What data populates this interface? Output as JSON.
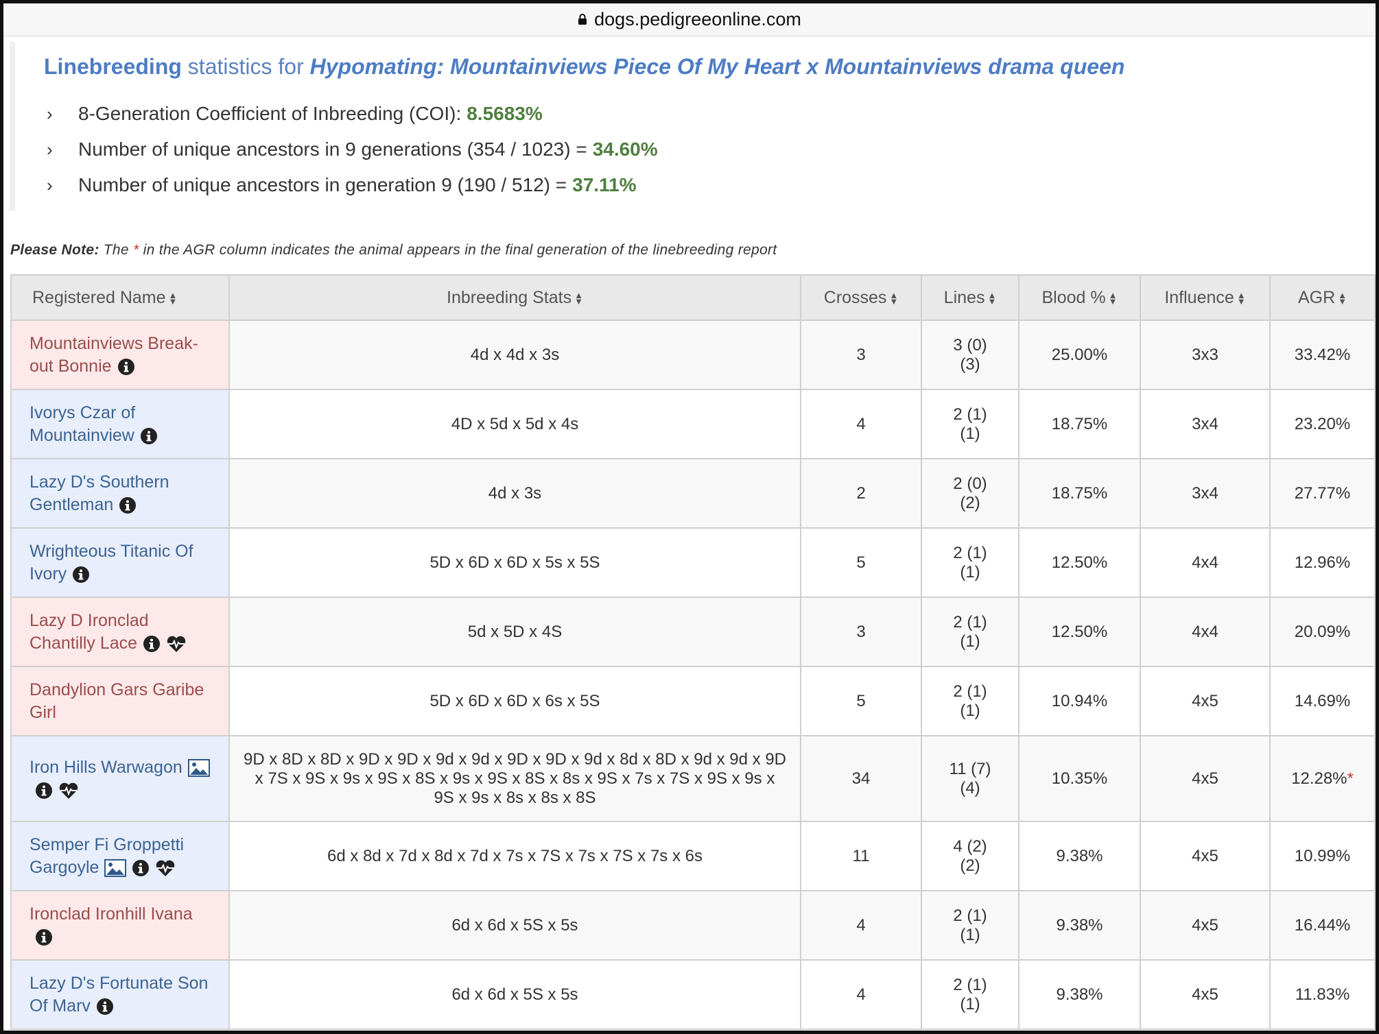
{
  "browser": {
    "url": "dogs.pedigreeonline.com"
  },
  "header": {
    "title_prefix": "Linebreeding",
    "title_mid": "statistics for",
    "title_mating": "Hypomating: Mountainviews Piece Of My Heart x Mountainviews drama queen"
  },
  "stats": [
    {
      "label": "8-Generation Coefficient of Inbreeding (COI):",
      "value": "8.5683%"
    },
    {
      "label": "Number of unique ancestors in 9 generations (354 / 1023) =",
      "value": "34.60%"
    },
    {
      "label": "Number of unique ancestors in generation 9 (190 / 512) =",
      "value": "37.11%"
    }
  ],
  "note": {
    "bold": "Please Note:",
    "pre": "The",
    "star": "*",
    "post": "in the AGR column indicates the animal appears in the final generation of the linebreeding report"
  },
  "table": {
    "headers": [
      "Registered Name",
      "Inbreeding Stats",
      "Crosses",
      "Lines",
      "Blood %",
      "Influence",
      "AGR"
    ],
    "rows": [
      {
        "sex": "female",
        "name": "Mountainviews Break-out Bonnie",
        "icons": [
          "info"
        ],
        "stats": "4d x 4d x 3s",
        "crosses": "3",
        "lines1": "3 (0)",
        "lines2": "(3)",
        "blood": "25.00%",
        "influence": "3x3",
        "agr": "33.42%",
        "agr_star": ""
      },
      {
        "sex": "male",
        "name": "Ivorys Czar of Mountainview",
        "icons": [
          "info"
        ],
        "stats": "4D x 5d x 5d x 4s",
        "crosses": "4",
        "lines1": "2 (1)",
        "lines2": "(1)",
        "blood": "18.75%",
        "influence": "3x4",
        "agr": "23.20%",
        "agr_star": ""
      },
      {
        "sex": "male",
        "name": "Lazy D's Southern Gentleman",
        "icons": [
          "info"
        ],
        "stats": "4d x 3s",
        "crosses": "2",
        "lines1": "2 (0)",
        "lines2": "(2)",
        "blood": "18.75%",
        "influence": "3x4",
        "agr": "27.77%",
        "agr_star": ""
      },
      {
        "sex": "male",
        "name": "Wrighteous Titanic Of Ivory",
        "icons": [
          "info"
        ],
        "stats": "5D x 6D x 6D x 5s x 5S",
        "crosses": "5",
        "lines1": "2 (1)",
        "lines2": "(1)",
        "blood": "12.50%",
        "influence": "4x4",
        "agr": "12.96%",
        "agr_star": ""
      },
      {
        "sex": "female",
        "name": "Lazy D Ironclad Chantilly Lace",
        "icons": [
          "info",
          "health"
        ],
        "stats": "5d x 5D x 4S",
        "crosses": "3",
        "lines1": "2 (1)",
        "lines2": "(1)",
        "blood": "12.50%",
        "influence": "4x4",
        "agr": "20.09%",
        "agr_star": ""
      },
      {
        "sex": "female",
        "name": "Dandylion Gars Garibe Girl",
        "icons": [],
        "stats": "5D x 6D x 6D x 6s x 5S",
        "crosses": "5",
        "lines1": "2 (1)",
        "lines2": "(1)",
        "blood": "10.94%",
        "influence": "4x5",
        "agr": "14.69%",
        "agr_star": ""
      },
      {
        "sex": "male",
        "name": "Iron Hills Warwagon",
        "icons": [
          "photo",
          "info",
          "health"
        ],
        "stats": "9D x 8D x 8D x 9D x 9D x 9d x 9d x 9D x 9D x 9d x 8d x 8D x 9d x 9d x 9D x 7S x 9S x 9s x 9S x 8S x 9s x 9S x 8S x 8s x 9S x 7s x 7S x 9S x 9s x 9S x 9s x 8s x 8s x 8S",
        "crosses": "34",
        "lines1": "11 (7)",
        "lines2": "(4)",
        "blood": "10.35%",
        "influence": "4x5",
        "agr": "12.28%",
        "agr_star": "*"
      },
      {
        "sex": "male",
        "name": "Semper Fi Groppetti Gargoyle",
        "icons": [
          "photo",
          "info",
          "health"
        ],
        "stats": "6d x 8d x 7d x 8d x 7d x 7s x 7S x 7s x 7S x 7s x 6s",
        "crosses": "11",
        "lines1": "4 (2)",
        "lines2": "(2)",
        "blood": "9.38%",
        "influence": "4x5",
        "agr": "10.99%",
        "agr_star": ""
      },
      {
        "sex": "female",
        "name": "Ironclad Ironhill Ivana",
        "icons": [
          "info"
        ],
        "stats": "6d x 6d x 5S x 5s",
        "crosses": "4",
        "lines1": "2 (1)",
        "lines2": "(1)",
        "blood": "9.38%",
        "influence": "4x5",
        "agr": "16.44%",
        "agr_star": ""
      },
      {
        "sex": "male",
        "name": "Lazy D's Fortunate Son Of Marv",
        "icons": [
          "info"
        ],
        "stats": "6d x 6d x 5S x 5s",
        "crosses": "4",
        "lines1": "2 (1)",
        "lines2": "(1)",
        "blood": "9.38%",
        "influence": "4x5",
        "agr": "11.83%",
        "agr_star": ""
      }
    ]
  },
  "colors": {
    "title_blue": "#4e7cc4",
    "value_green": "#4f7f3f",
    "female_bg": "#fde9e9",
    "male_bg": "#e8eefb",
    "star_red": "#c0392b"
  }
}
